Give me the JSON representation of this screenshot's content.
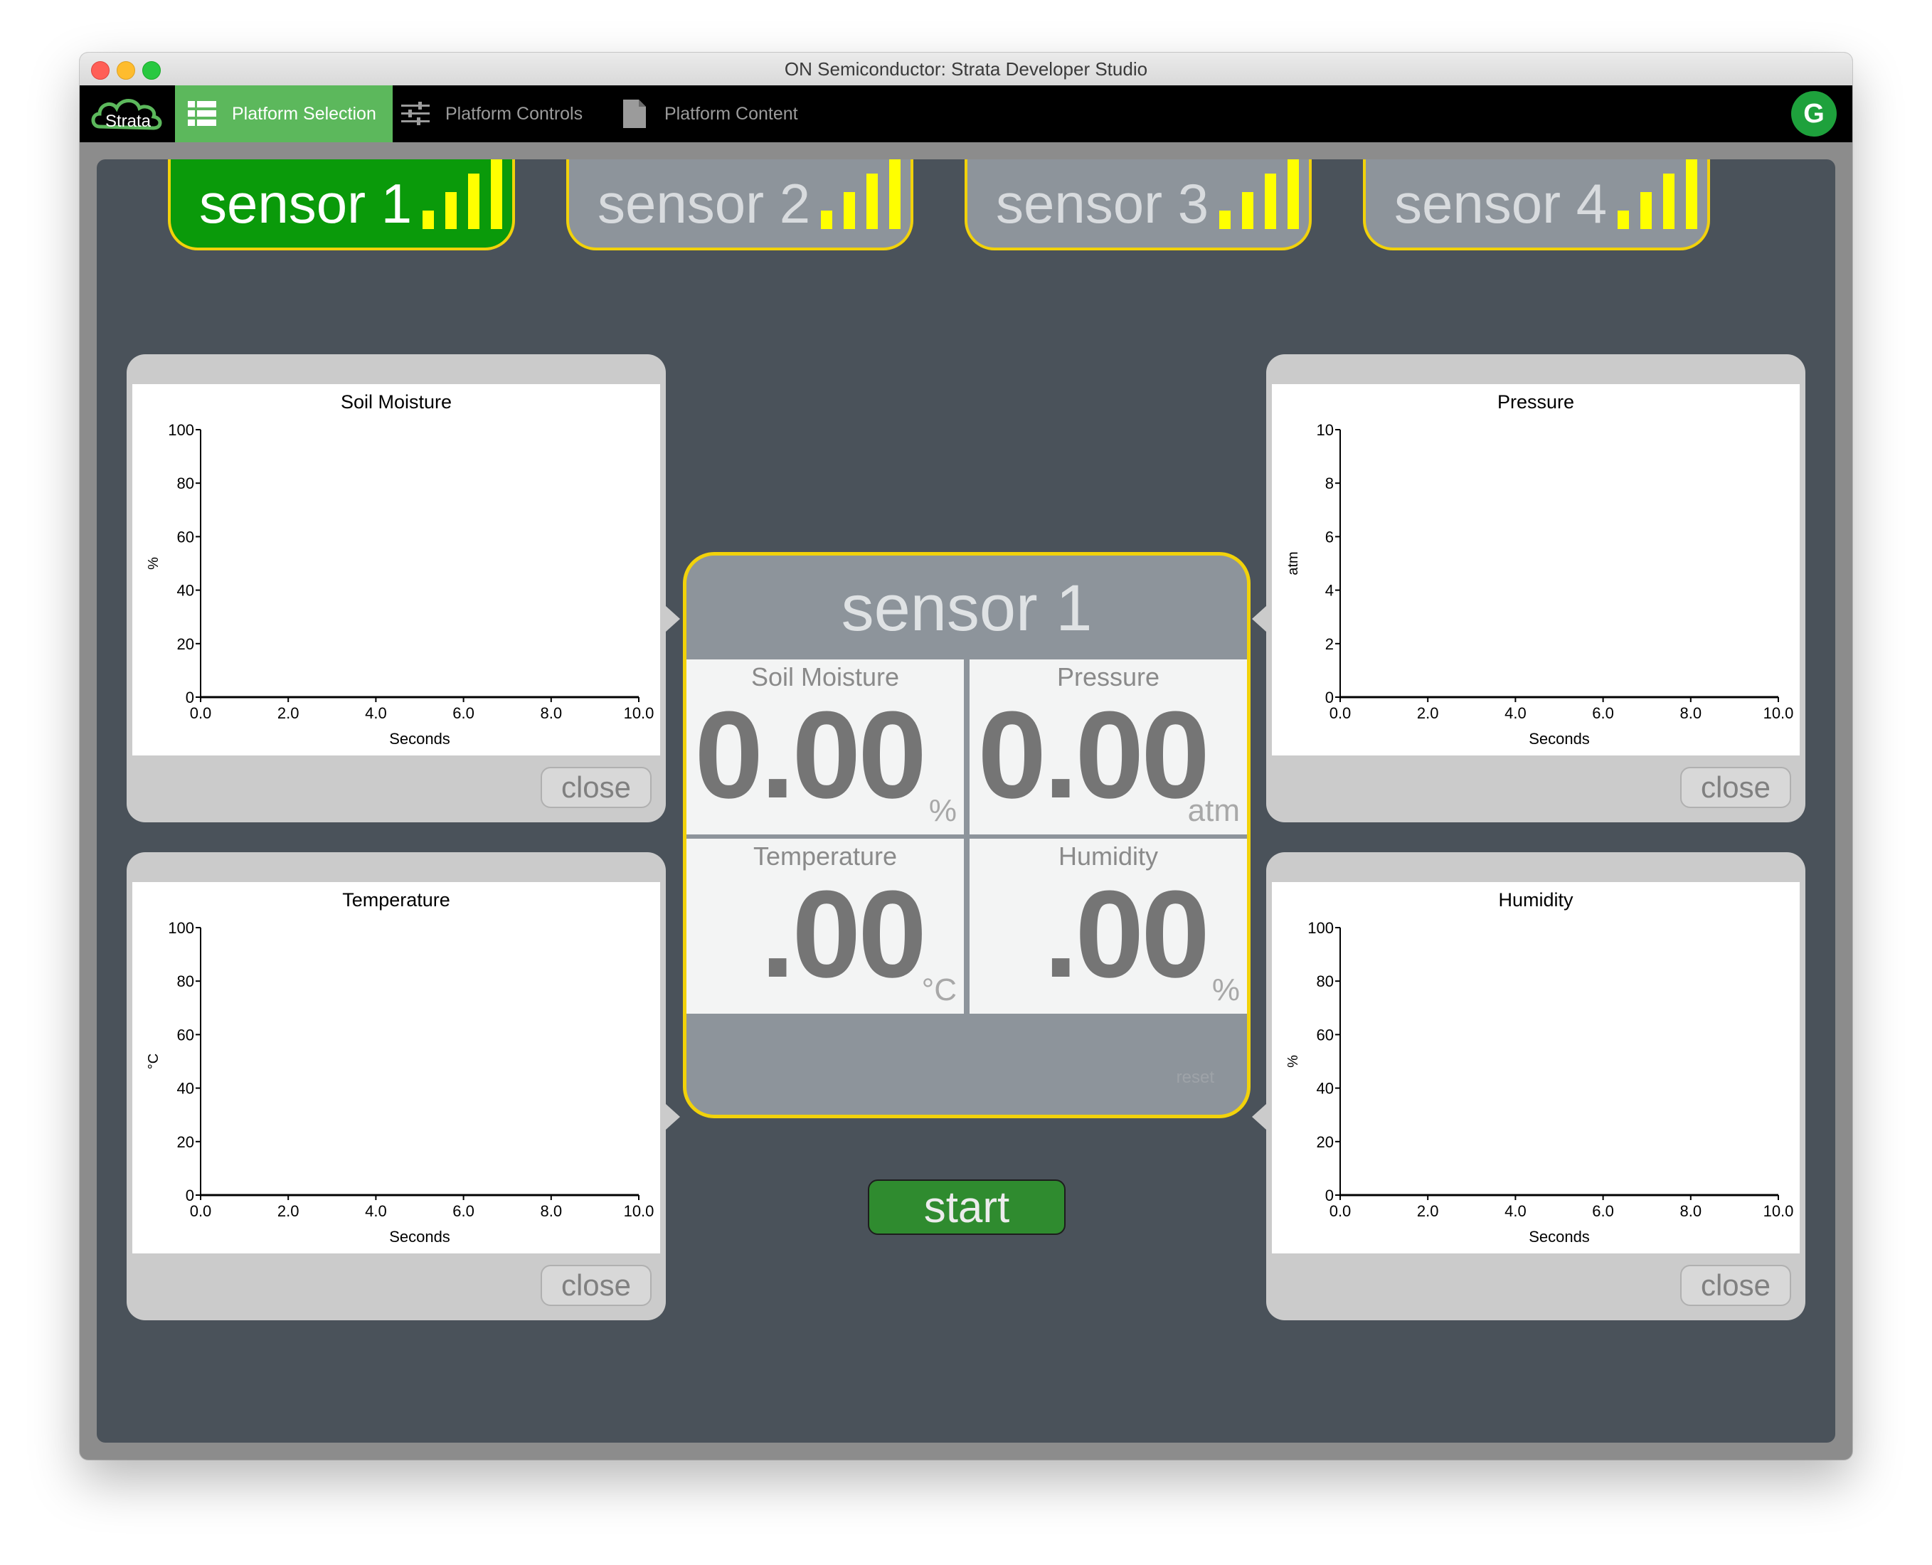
{
  "window": {
    "title": "ON Semiconductor: Strata Developer Studio"
  },
  "navbar": {
    "logo_text": "Strata",
    "items": [
      {
        "label": "Platform Selection",
        "icon": "list-icon",
        "active": true
      },
      {
        "label": "Platform Controls",
        "icon": "sliders-icon",
        "active": false
      },
      {
        "label": "Platform Content",
        "icon": "document-icon",
        "active": false
      }
    ],
    "avatar_initial": "G"
  },
  "sensor_tabs": [
    {
      "label": "sensor 1",
      "selected": true,
      "signal_bars": 4
    },
    {
      "label": "sensor 2",
      "selected": false,
      "signal_bars": 4
    },
    {
      "label": "sensor 3",
      "selected": false,
      "signal_bars": 4
    },
    {
      "label": "sensor 4",
      "selected": false,
      "signal_bars": 4
    }
  ],
  "center_panel": {
    "title": "sensor 1",
    "readings": [
      {
        "label": "Soil Moisture",
        "value": "0.00",
        "unit": "%"
      },
      {
        "label": "Pressure",
        "value": "0.00",
        "unit": "atm"
      },
      {
        "label": "Temperature",
        "value": ".00",
        "unit": "°C"
      },
      {
        "label": "Humidity",
        "value": ".00",
        "unit": "%"
      }
    ],
    "reset_label": "reset"
  },
  "start_button": {
    "label": "start"
  },
  "close_label": "close",
  "colors": {
    "accent_green": "#5cb85c",
    "selected_tab": "#0a9a0a",
    "tab_border": "#f2d20a",
    "signal_bar": "#ffff00",
    "background": "#4a525a"
  },
  "chart_data": [
    {
      "type": "line",
      "title": "Soil Moisture",
      "xlabel": "Seconds",
      "ylabel": "%",
      "xlim": [
        0,
        10
      ],
      "ylim": [
        0,
        100
      ],
      "xticks": [
        "0.0",
        "2.0",
        "4.0",
        "6.0",
        "8.0",
        "10.0"
      ],
      "yticks": [
        "0",
        "20",
        "40",
        "60",
        "80",
        "100"
      ],
      "series": [],
      "grid": false
    },
    {
      "type": "line",
      "title": "Pressure",
      "xlabel": "Seconds",
      "ylabel": "atm",
      "xlim": [
        0,
        10
      ],
      "ylim": [
        0,
        10
      ],
      "xticks": [
        "0.0",
        "2.0",
        "4.0",
        "6.0",
        "8.0",
        "10.0"
      ],
      "yticks": [
        "0",
        "2",
        "4",
        "6",
        "8",
        "10"
      ],
      "series": [],
      "grid": false
    },
    {
      "type": "line",
      "title": "Temperature",
      "xlabel": "Seconds",
      "ylabel": "°C",
      "xlim": [
        0,
        10
      ],
      "ylim": [
        0,
        100
      ],
      "xticks": [
        "0.0",
        "2.0",
        "4.0",
        "6.0",
        "8.0",
        "10.0"
      ],
      "yticks": [
        "0",
        "20",
        "40",
        "60",
        "80",
        "100"
      ],
      "series": [],
      "grid": false
    },
    {
      "type": "line",
      "title": "Humidity",
      "xlabel": "Seconds",
      "ylabel": "%",
      "xlim": [
        0,
        10
      ],
      "ylim": [
        0,
        100
      ],
      "xticks": [
        "0.0",
        "2.0",
        "4.0",
        "6.0",
        "8.0",
        "10.0"
      ],
      "yticks": [
        "0",
        "20",
        "40",
        "60",
        "80",
        "100"
      ],
      "series": [],
      "grid": false
    }
  ]
}
